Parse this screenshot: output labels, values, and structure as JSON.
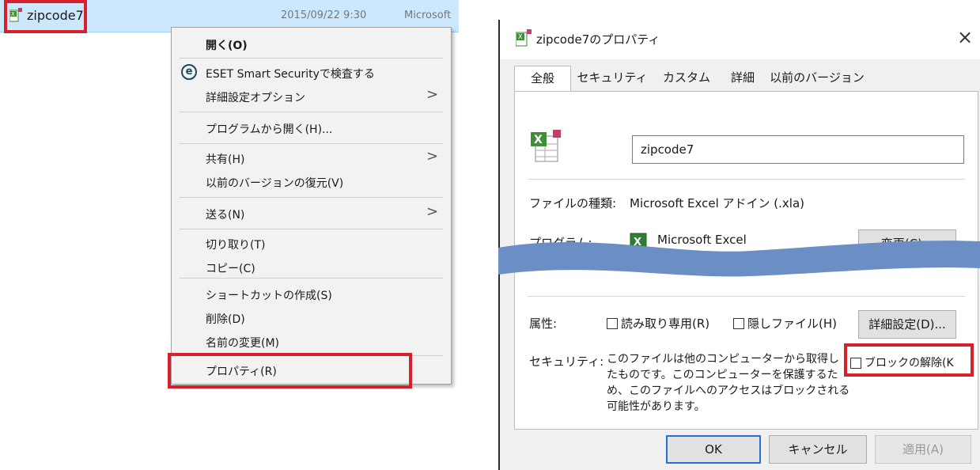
{
  "explorer": {
    "file_name": "zipcode7",
    "date": "2015/09/22 9:30",
    "type_partial": "Microsoft"
  },
  "context_menu": {
    "items": [
      {
        "label": "開く(O)"
      },
      {
        "label": "ESET Smart Securityで検査する"
      },
      {
        "label": "詳細設定オプション"
      },
      {
        "label": "プログラムから開く(H)..."
      },
      {
        "label": "共有(H)"
      },
      {
        "label": "以前のバージョンの復元(V)"
      },
      {
        "label": "送る(N)"
      },
      {
        "label": "切り取り(T)"
      },
      {
        "label": "コピー(C)"
      },
      {
        "label": "ショートカットの作成(S)"
      },
      {
        "label": "削除(D)"
      },
      {
        "label": "名前の変更(M)"
      },
      {
        "label": "プロパティ(R)"
      }
    ],
    "submenu_arrow": ">"
  },
  "dialog": {
    "title": "zipcode7のプロパティ",
    "close": "×",
    "tabs": [
      "全般",
      "セキュリティ",
      "カスタム",
      "詳細",
      "以前のバージョン"
    ],
    "name_value": "zipcode7",
    "file_type_label": "ファイルの種類:",
    "file_type_value": "Microsoft Excel アドイン (.xla)",
    "program_label": "プログラム:",
    "program_value": "Microsoft Excel",
    "change_button": "変更(C)...",
    "attributes_label": "属性:",
    "readonly_label": "読み取り専用(R)",
    "hidden_label": "隠しファイル(H)",
    "advanced_button": "詳細設定(D)...",
    "security_label": "セキュリティ:",
    "security_text": [
      "このファイルは他のコンピューターから取得し",
      "たものです。このコンピューターを保護するた",
      "め、このファイルへのアクセスはブロックされる",
      "可能性があります。"
    ],
    "unblock_label": "ブロックの解除(K",
    "ok_button": "OK",
    "cancel_button": "キャンセル",
    "apply_button": "適用(A)"
  },
  "colors": {
    "highlight_red": "#d6202c",
    "selection_blue": "#cce8ff",
    "wave_blue": "#6b8fc4"
  }
}
